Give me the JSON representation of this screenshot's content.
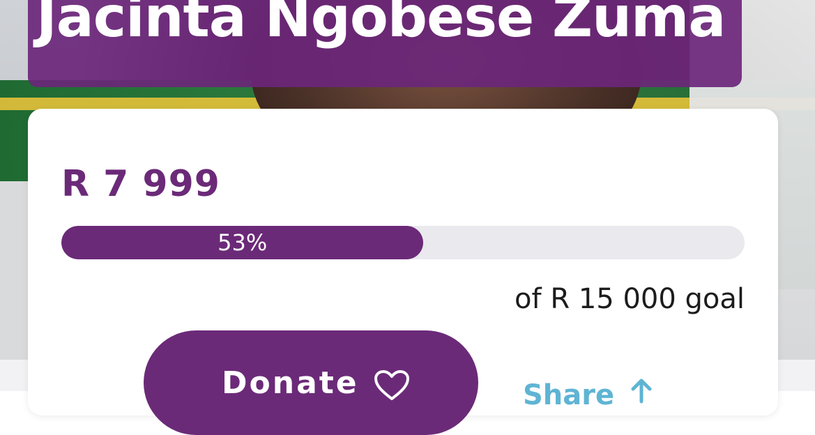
{
  "campaign": {
    "name": "Jacinta Ngobese Zuma"
  },
  "funding": {
    "raised": "R 7 999",
    "progress_percent": 53,
    "progress_label": "53%",
    "goal_text": "of R 15 000 goal"
  },
  "actions": {
    "donate_label": "Donate",
    "share_label": "Share"
  },
  "icons": {
    "donate": "heart-icon",
    "share": "share-icon"
  },
  "colors": {
    "brand": "#6b2a78",
    "progress_track": "#e9e9ee",
    "share": "#5fb4d3",
    "card": "#ffffff"
  }
}
